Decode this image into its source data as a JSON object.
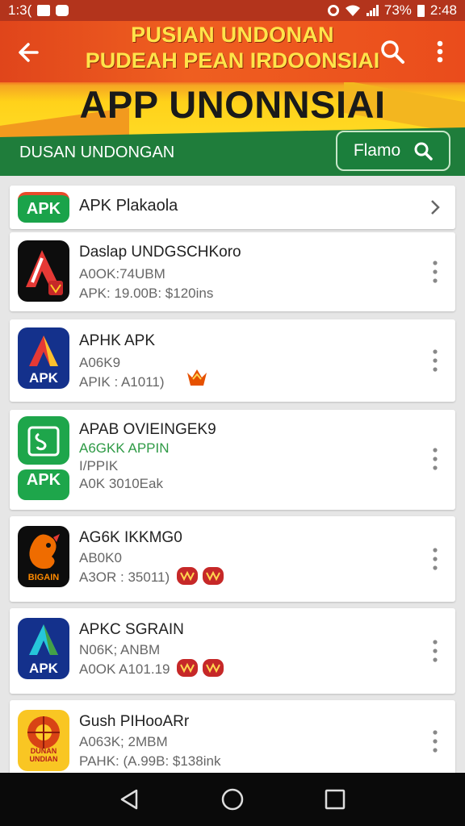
{
  "status_bar": {
    "time_left": "1:3(",
    "battery": "73%",
    "time_right": "2:48"
  },
  "header": {
    "title_line1": "PUSIAN UNDONAN",
    "title_line2": "PUDEAH PEAN IRDOONSIAI",
    "big_title": "APP UNONNSIAI",
    "subtitle": "DUSAN UNDONGAN",
    "filter_button_label": "Flamo"
  },
  "first_item": {
    "badge": "APK",
    "label": "APK Plakaola"
  },
  "apps": [
    {
      "name": "Daslap UNDGSCHKoro",
      "line1": "A0OK:74UBM",
      "line2": "APK: 19.00B: $120ins",
      "icon": "triangle-logo-icon"
    },
    {
      "name": "APHK APK",
      "line1": "A06K9",
      "line2": "APIK : A1011)",
      "icon": "apk-logo-icon"
    },
    {
      "name": "APAB OVIEINGEK9",
      "line1": "A6GKK APPIN",
      "line2": "I/PPIK",
      "line3": "A0K 3010Eak",
      "icon": "shop-bag-icon",
      "badge": "APK"
    },
    {
      "name": "AG6K IKKMG0",
      "line1": "AB0K0",
      "line2": "A3OR : 35011)",
      "icon": "rooster-logo-icon",
      "icon_text": "BIGAIN"
    },
    {
      "name": "APKC SGRAIN",
      "line1": "N06K; ANBM",
      "line2": "A0OK A101.19",
      "icon": "apk-logo-icon-blue"
    },
    {
      "name": "Gush PIHooARr",
      "line1": "A063K; 2MBM",
      "line2": "PAHK: (A.99B: $138ink",
      "icon": "emblem-logo-icon",
      "icon_text": "DUNAN UNDIAN"
    }
  ],
  "colors": {
    "header_orange": "#e8531f",
    "header_yellow": "#ffd21a",
    "header_green": "#1e7a3a",
    "apk_green": "#1aa34a"
  }
}
